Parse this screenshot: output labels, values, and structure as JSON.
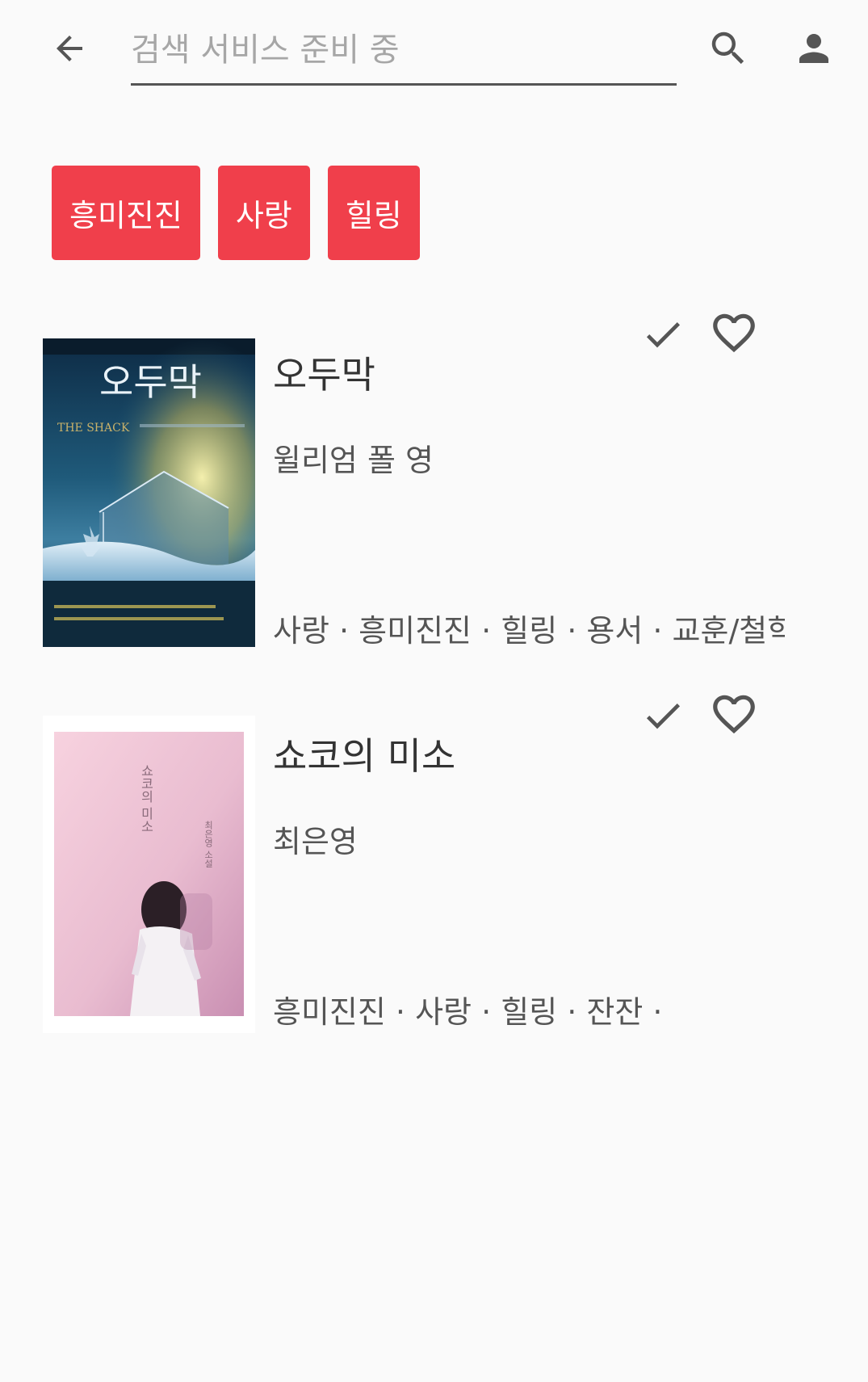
{
  "search": {
    "placeholder": "검색 서비스 준비 중",
    "value": ""
  },
  "icons": {
    "back": "arrow-back-icon",
    "search": "search-icon",
    "account": "person-icon",
    "read": "check-icon",
    "like": "heart-outline-icon"
  },
  "colors": {
    "chip_background": "#f03f4b",
    "chip_text": "#ffffff",
    "icon": "#555555",
    "page_background": "#fafafa"
  },
  "tag_filters": [
    {
      "label": "흥미진진"
    },
    {
      "label": "사랑"
    },
    {
      "label": "힐링"
    }
  ],
  "books": [
    {
      "title": "오두막",
      "author": "윌리엄 폴 영",
      "tags": "사랑 · 흥미진진 · 힐링 · 용서 · 교훈/철학",
      "cover": {
        "title_text": "오두막",
        "subtitle_text": "THE SHACK"
      }
    },
    {
      "title": "쇼코의 미소",
      "author": "최은영",
      "tags": "흥미진진 · 사랑 · 힐링 · 잔잔 ·",
      "cover": {
        "title_text": "쇼코의 미소",
        "author_text": "최은영 소설"
      }
    }
  ]
}
